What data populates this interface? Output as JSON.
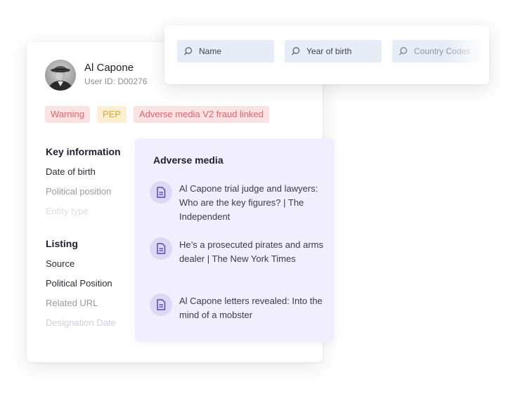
{
  "search": {
    "fields": [
      {
        "label": "Name",
        "icon": "search-icon"
      },
      {
        "label": "Year of birth",
        "icon": "search-icon"
      },
      {
        "label": "Country Codes",
        "icon": "search-icon"
      }
    ]
  },
  "profile": {
    "name": "Al Capone",
    "user_id": "User ID: D00276",
    "badges": [
      {
        "label": "Warning",
        "color": "#e0656b",
        "bg": "#fbe3e4"
      },
      {
        "label": "PEP",
        "color": "#e3a13a",
        "bg": "#fdf0d2"
      },
      {
        "label": "Adverse media V2 fraud linked",
        "color": "#e0656b",
        "bg": "#fbe3e4"
      }
    ],
    "key_information": {
      "title": "Key information",
      "fields": [
        "Date of birth",
        "Political position",
        "Entity type"
      ]
    },
    "listing": {
      "title": "Listing",
      "fields": [
        "Source",
        "Political Position",
        "Related URL",
        "Designation Date"
      ]
    }
  },
  "adverse_media": {
    "title": "Adverse media",
    "icon": "document-icon",
    "accent": "#5b47b8",
    "items": [
      "Al Capone trial judge and lawyers: Who are the key figures? | The Independent",
      "He’s a prosecuted pirates and arms dealer | The New York Times",
      "Al Capone letters revealed: Into the mind of a mobster"
    ]
  }
}
